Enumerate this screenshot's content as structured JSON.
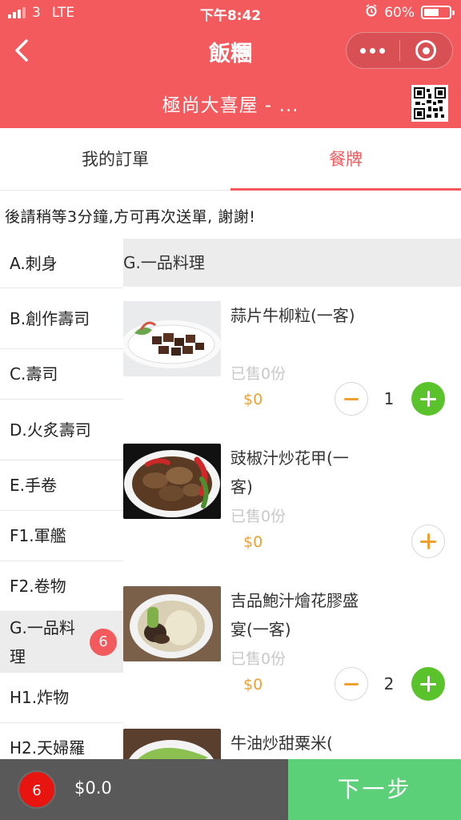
{
  "status_bar": {
    "carrier": "3",
    "network": "LTE",
    "time": "下午8:42",
    "battery": "60%",
    "battery_level": 0.6
  },
  "nav": {
    "title": "飯糰",
    "back_icon": "chevron-left-icon",
    "more_icon": "more-dots-icon",
    "close_icon": "target-circle-icon"
  },
  "restaurant": {
    "name": "極尚大喜屋 - ...",
    "qr_icon": "qr-code-icon"
  },
  "tabs": [
    {
      "label": "我的訂單",
      "active": false
    },
    {
      "label": "餐牌",
      "active": true
    }
  ],
  "notice": "後請稍等3分鐘,方可再次送單, 謝謝!",
  "categories": [
    {
      "label": "A.刺身"
    },
    {
      "label": "B.創作壽司"
    },
    {
      "label": "C.壽司"
    },
    {
      "label": "D.火炙壽司"
    },
    {
      "label": "E.手卷"
    },
    {
      "label": "F1.軍艦"
    },
    {
      "label": "F2.卷物"
    },
    {
      "label": "G.一品料理",
      "badge": "6"
    },
    {
      "label": "H1.炸物"
    },
    {
      "label": "H2.天婦羅"
    }
  ],
  "menu": {
    "section_title": "G.一品料理",
    "items": [
      {
        "name": "蒜片牛柳粒(一客)",
        "sold": "已售0份",
        "price": "$0",
        "qty": "1"
      },
      {
        "name": "豉椒汁炒花甲(一客)",
        "sold": "已售0份",
        "price": "$0"
      },
      {
        "name": "吉品鮑汁燴花膠盛宴(一客)",
        "sold": "已售0份",
        "price": "$0",
        "qty": "2"
      },
      {
        "name": "牛油炒甜粟米("
      }
    ]
  },
  "cart": {
    "count": "6",
    "total": "$0.0",
    "next_label": "下一步"
  },
  "colors": {
    "brand": "#f25a5e",
    "add": "#5ac22a",
    "price": "#f0a030",
    "next": "#5ccf79",
    "cart_bar": "#595959"
  }
}
